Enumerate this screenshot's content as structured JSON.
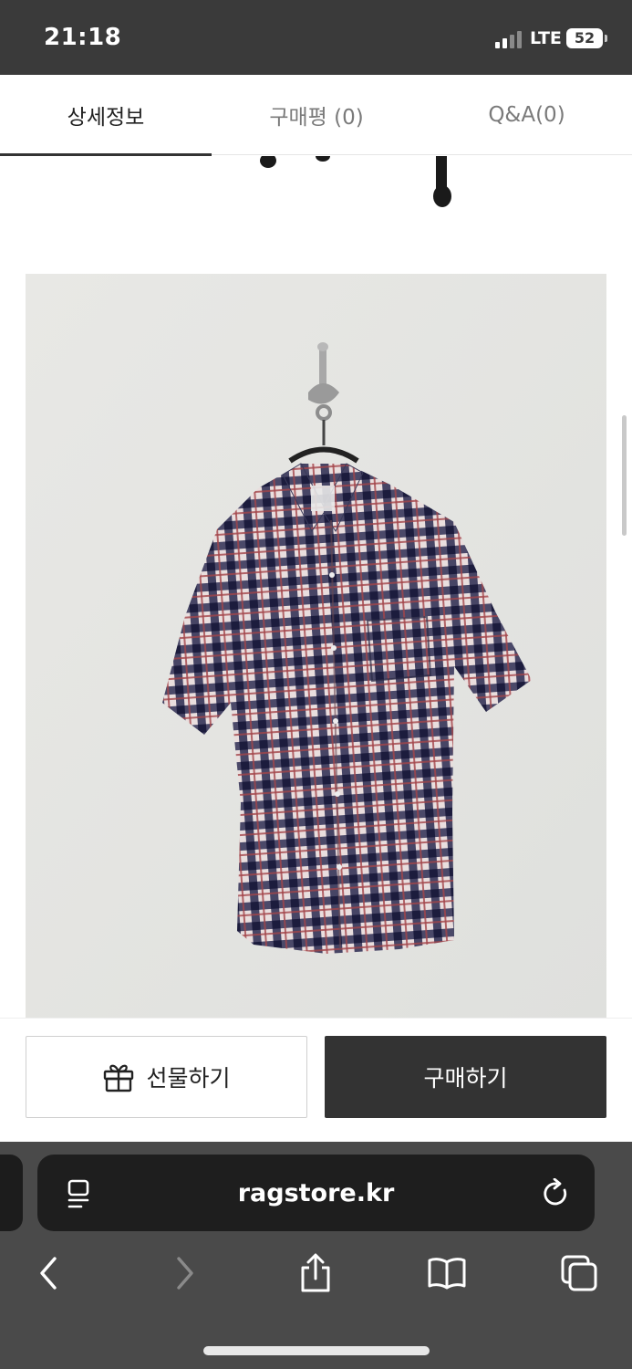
{
  "status_bar": {
    "time": "21:18",
    "network": "LTE",
    "battery": "52"
  },
  "tabs": [
    {
      "label": "상세정보",
      "active": true
    },
    {
      "label": "구매평 (0)",
      "active": false
    },
    {
      "label": "Q&A(0)",
      "active": false
    }
  ],
  "purchase": {
    "gift_label": "선물하기",
    "buy_label": "구매하기"
  },
  "browser": {
    "url": "ragstore.kr"
  },
  "colors": {
    "status_bg": "#3a3a3a",
    "buy_bg": "#333333",
    "browser_bg": "#4a4a4a"
  },
  "icons": {
    "gift": "gift-icon",
    "reader": "reader-icon",
    "reload": "reload-icon",
    "back": "back-icon",
    "forward": "forward-icon",
    "share": "share-icon",
    "bookmarks": "bookmarks-icon",
    "tabs": "tabs-icon"
  }
}
